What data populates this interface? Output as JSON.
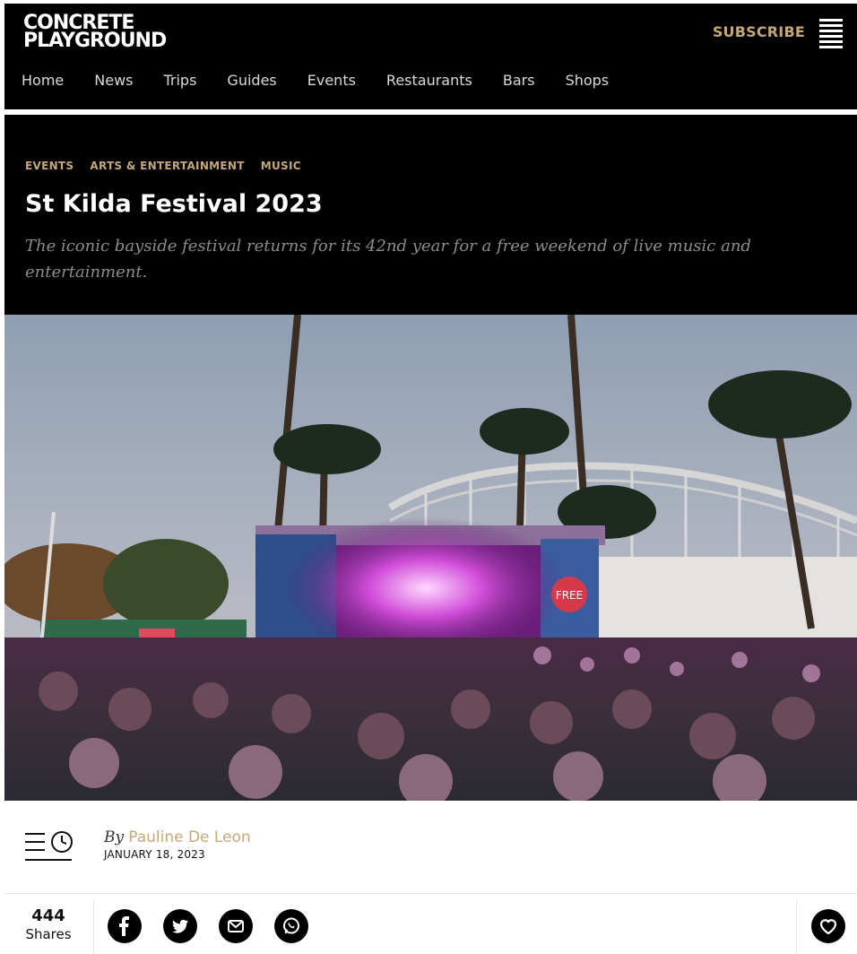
{
  "header": {
    "logo_line1": "CONCRETE",
    "logo_line2": "PLAYGROUND",
    "subscribe_label": "SUBSCRIBE",
    "nav": [
      "Home",
      "News",
      "Trips",
      "Guides",
      "Events",
      "Restaurants",
      "Bars",
      "Shops"
    ]
  },
  "article": {
    "categories": [
      "EVENTS",
      "ARTS & ENTERTAINMENT",
      "MUSIC"
    ],
    "title": "St Kilda Festival 2023",
    "subtitle": "The iconic bayside festival returns for its 42nd year for a free weekend of live music and entertainment.",
    "photo_banner_text": "FREE",
    "byline_prefix": "By",
    "author": "Pauline De Leon",
    "date": "JANUARY 18, 2023"
  },
  "share": {
    "count": "444",
    "label": "Shares",
    "buttons": [
      "facebook-icon",
      "twitter-icon",
      "email-icon",
      "whatsapp-icon"
    ]
  },
  "colors": {
    "accent_gold": "#c5a878",
    "bar_black": "#000000",
    "subtitle_grey": "#8c8c8c"
  }
}
